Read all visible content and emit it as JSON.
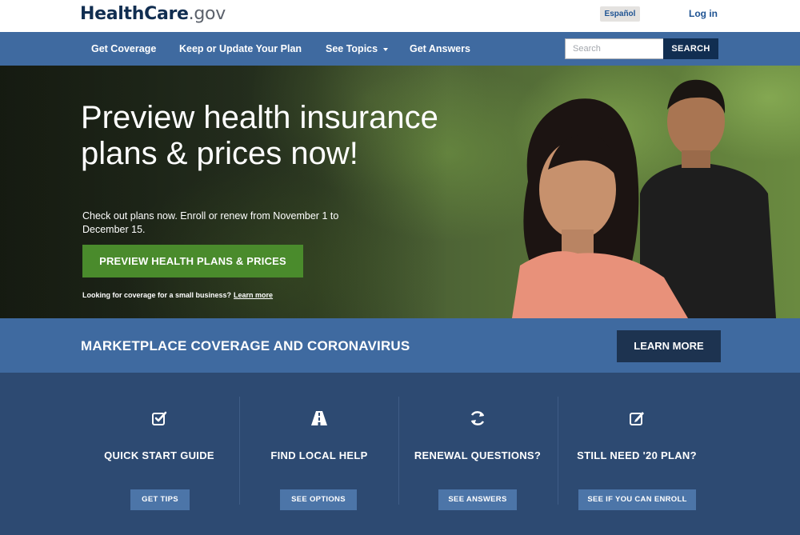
{
  "header": {
    "logo_brand": "HealthCare",
    "logo_tld": ".gov",
    "language_link": "Español",
    "login_link": "Log in"
  },
  "nav": {
    "items": [
      {
        "label": "Get Coverage"
      },
      {
        "label": "Keep or Update Your Plan"
      },
      {
        "label": "See Topics"
      },
      {
        "label": "Get Answers"
      }
    ],
    "search_placeholder": "Search",
    "search_button": "SEARCH"
  },
  "hero": {
    "title": "Preview health insurance plans & prices now!",
    "subtitle": "Check out plans now. Enroll or renew from November 1 to December 15.",
    "cta": "PREVIEW HEALTH PLANS & PRICES",
    "small_text": "Looking for coverage for a small business?",
    "small_link": "Learn more"
  },
  "banner": {
    "title": "MARKETPLACE COVERAGE AND CORONAVIRUS",
    "button": "LEARN MORE"
  },
  "cards": [
    {
      "icon": "checkbox-icon",
      "title": "QUICK START GUIDE",
      "button": "GET TIPS"
    },
    {
      "icon": "road-icon",
      "title": "FIND LOCAL HELP",
      "button": "SEE OPTIONS"
    },
    {
      "icon": "refresh-icon",
      "title": "RENEWAL QUESTIONS?",
      "button": "SEE ANSWERS"
    },
    {
      "icon": "edit-icon",
      "title": "STILL NEED '20 PLAN?",
      "button": "SEE IF YOU CAN ENROLL"
    }
  ],
  "colors": {
    "brand_navy": "#112e51",
    "nav_blue": "#3f6aa0",
    "cta_green": "#4a8b2c",
    "cards_bg": "#2d4a72",
    "card_button": "#4c75a8"
  }
}
